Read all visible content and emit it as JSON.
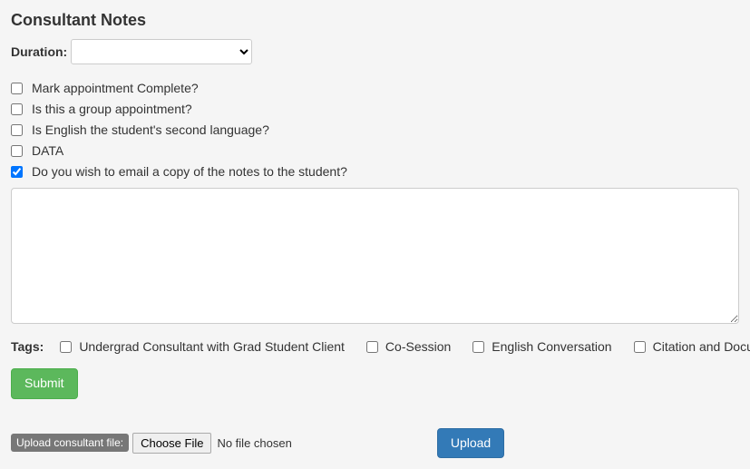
{
  "heading": "Consultant Notes",
  "duration": {
    "label": "Duration:",
    "value": ""
  },
  "checks": [
    {
      "label": "Mark appointment Complete?",
      "checked": false
    },
    {
      "label": "Is this a group appointment?",
      "checked": false
    },
    {
      "label": "Is English the student's second language?",
      "checked": false
    },
    {
      "label": "DATA",
      "checked": false
    },
    {
      "label": "Do you wish to email a copy of the notes to the student?",
      "checked": true
    }
  ],
  "notes_value": "",
  "tags": {
    "label": "Tags:",
    "items": [
      {
        "label": "Undergrad Consultant with Grad Student Client",
        "checked": false
      },
      {
        "label": "Co-Session",
        "checked": false
      },
      {
        "label": "English Conversation",
        "checked": false
      },
      {
        "label": "Citation and Documentation",
        "checked": false
      }
    ]
  },
  "buttons": {
    "submit": "Submit",
    "upload": "Upload"
  },
  "upload": {
    "label": "Upload consultant file:",
    "choose": "Choose File",
    "status": "No file chosen"
  }
}
